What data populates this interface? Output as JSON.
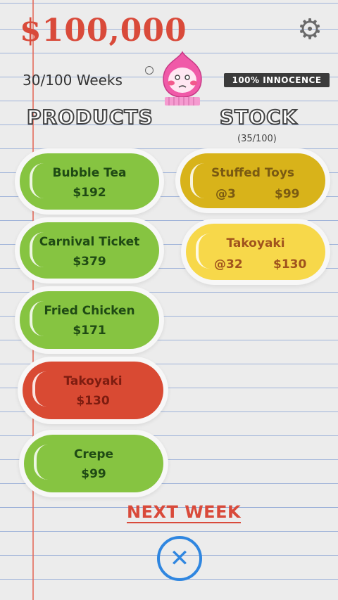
{
  "header": {
    "money": "$100,000",
    "weeks": "30/100 Weeks",
    "innocence": "100% INNOCENCE",
    "settings_icon": "gear-icon"
  },
  "products": {
    "title": "PRODUCTS",
    "items": [
      {
        "name": "Bubble Tea",
        "price": "$192",
        "color": "green"
      },
      {
        "name": "Carnival Ticket",
        "price": "$379",
        "color": "green"
      },
      {
        "name": "Fried Chicken",
        "price": "$171",
        "color": "green"
      },
      {
        "name": "Takoyaki",
        "price": "$130",
        "color": "red"
      },
      {
        "name": "Crepe",
        "price": "$99",
        "color": "green"
      }
    ]
  },
  "stock": {
    "title": "STOCK",
    "count": "(35/100)",
    "items": [
      {
        "name": "Stuffed Toys",
        "qty": "@3",
        "price": "$99",
        "color": "mustard"
      },
      {
        "name": "Takoyaki",
        "qty": "@32",
        "price": "$130",
        "color": "yellow"
      }
    ]
  },
  "footer": {
    "next_week": "NEXT WEEK",
    "close_icon": "close-icon"
  },
  "colors": {
    "money": "#d94a3a",
    "green": "#86c441",
    "red": "#d94a33",
    "mustard": "#d8b31a",
    "yellow": "#f7d84a",
    "close": "#2f86e0"
  }
}
